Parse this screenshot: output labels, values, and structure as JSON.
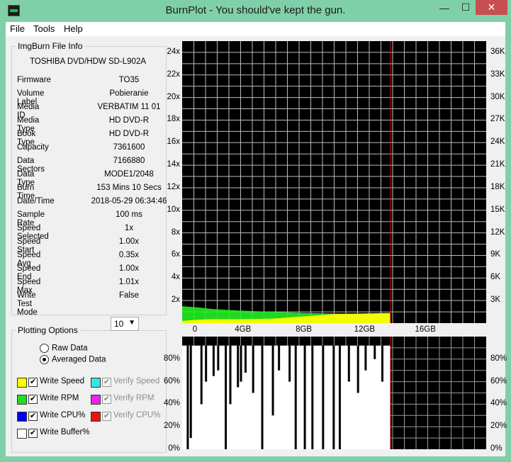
{
  "window": {
    "title": "BurnPlot - You should've kept the gun."
  },
  "menu": [
    "File",
    "Tools",
    "Help"
  ],
  "file_info": {
    "heading": "ImgBurn File Info",
    "drive": "TOSHIBA DVD/HDW SD-L902A",
    "rows": [
      {
        "label": "Firmware",
        "value": "TO35"
      },
      {
        "label": "Volume Label",
        "value": "Pobieranie"
      },
      {
        "label": "Media ID",
        "value": "VERBATIM 11 01"
      },
      {
        "label": "Media Type",
        "value": "HD DVD-R"
      },
      {
        "label": "Book Type",
        "value": "HD DVD-R"
      },
      {
        "label": "Capacity",
        "value": "7361600"
      },
      {
        "label": "Data Sectors",
        "value": "7166880"
      },
      {
        "label": "Data Type",
        "value": "MODE1/2048"
      },
      {
        "label": "Burn Time",
        "value": "153 Mins 10 Secs"
      },
      {
        "label": "Date/Time",
        "value": "2018-05-29 06:34:46"
      },
      {
        "label": "Sample Rate",
        "value": "100 ms"
      },
      {
        "label": "Speed Selected",
        "value": "1x"
      },
      {
        "label": "Speed Start",
        "value": "1.00x"
      },
      {
        "label": "Speed Avg",
        "value": "0.35x"
      },
      {
        "label": "Speed End",
        "value": "1.00x"
      },
      {
        "label": "Speed Max",
        "value": "1.01x"
      },
      {
        "label": "Write Test Mode",
        "value": "False"
      }
    ]
  },
  "plotting": {
    "heading": "Plotting Options",
    "raw_label": "Raw Data",
    "avg_label": "Averaged Data",
    "avg_value": "10",
    "selected": "averaged",
    "options": [
      {
        "label": "Write Speed",
        "color": "#ffff00",
        "checked": true,
        "enabled": true
      },
      {
        "label": "Verify Speed",
        "color": "#33e6e6",
        "checked": true,
        "enabled": false
      },
      {
        "label": "Write RPM",
        "color": "#22dd22",
        "checked": true,
        "enabled": true
      },
      {
        "label": "Verify RPM",
        "color": "#ee22ee",
        "checked": true,
        "enabled": false
      },
      {
        "label": "Write CPU%",
        "color": "#0000ee",
        "checked": true,
        "enabled": true
      },
      {
        "label": "Verify CPU%",
        "color": "#ee1111",
        "checked": true,
        "enabled": false
      },
      {
        "label": "Write Buffer%",
        "color": "#ffffff",
        "checked": true,
        "enabled": true
      }
    ]
  },
  "chart_data": [
    {
      "type": "line",
      "y_left_ticks": [
        "2x",
        "4x",
        "6x",
        "8x",
        "10x",
        "12x",
        "14x",
        "16x",
        "18x",
        "20x",
        "22x",
        "24x"
      ],
      "y_right_ticks": [
        "3K",
        "6K",
        "9K",
        "12K",
        "15K",
        "18K",
        "21K",
        "24K",
        "27K",
        "30K",
        "33K",
        "36K"
      ],
      "x_ticks": [
        "0",
        "4GB",
        "8GB",
        "12GB",
        "16GB"
      ],
      "xlim_gb": [
        0,
        20
      ],
      "ylim_speed": [
        0,
        25
      ],
      "marker_gb": 13.7,
      "series": [
        {
          "color": "#22ee22",
          "values_speed_x": [
            1.5,
            1.4,
            1.25,
            1.1,
            1.0,
            0.9,
            0.85,
            0.8
          ],
          "x_gb": [
            0,
            1,
            2,
            4,
            6,
            8,
            10,
            13.7
          ]
        },
        {
          "color": "#ffff00",
          "values_speed_x": [
            0.2,
            0.3,
            0.35,
            0.35,
            0.4,
            0.6,
            0.8,
            0.9
          ],
          "x_gb": [
            0,
            1,
            2,
            4,
            6,
            8,
            10,
            13.7
          ]
        }
      ]
    },
    {
      "type": "line",
      "y_ticks": [
        "0%",
        "20%",
        "40%",
        "60%",
        "80%"
      ],
      "ylim": [
        0,
        100
      ],
      "xlim_gb": [
        0,
        20
      ],
      "marker_gb": 13.7,
      "series": [
        {
          "color": "#ffffff",
          "base_pct": 92,
          "dips_gb": [
            0.3,
            0.5,
            1.2,
            1.5,
            2.0,
            2.3,
            2.8,
            3.1,
            3.6,
            3.8,
            4.1,
            4.6,
            5.2,
            5.9,
            6.3,
            7.0,
            7.4,
            8.0,
            8.5,
            9.2,
            9.9,
            10.3,
            10.9,
            11.5,
            12.0,
            12.6,
            13.1
          ],
          "dips_pct": [
            0,
            10,
            40,
            60,
            65,
            70,
            0,
            40,
            55,
            60,
            68,
            50,
            0,
            30,
            70,
            60,
            0,
            0,
            0,
            0,
            0,
            0,
            60,
            50,
            70,
            80,
            60
          ]
        }
      ]
    }
  ]
}
